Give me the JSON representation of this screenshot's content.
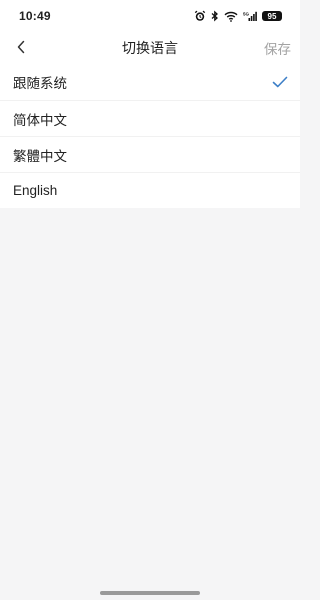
{
  "status_bar": {
    "time": "10:49",
    "battery": "95",
    "icons": [
      "alarm-icon",
      "bluetooth-icon",
      "wifi-icon",
      "cellular-5g-icon",
      "battery-icon"
    ]
  },
  "nav": {
    "back_icon": "chevron-left-icon",
    "title": "切换语言",
    "save_label": "保存"
  },
  "languages": [
    {
      "label": "跟随系统",
      "selected": true
    },
    {
      "label": "简体中文",
      "selected": false
    },
    {
      "label": "繁體中文",
      "selected": false
    },
    {
      "label": "English",
      "selected": false
    }
  ],
  "colors": {
    "accent": "#3d7fc7",
    "save_disabled": "#a3a3a3",
    "background": "#f5f5f6"
  }
}
